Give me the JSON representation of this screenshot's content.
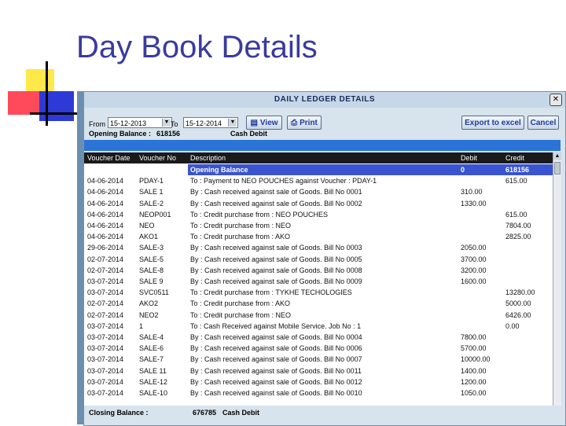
{
  "slide": {
    "title": "Day Book Details"
  },
  "window": {
    "title": "DAILY LEDGER DETAILS",
    "close_glyph": "✕",
    "filter": {
      "from_label": "From",
      "from_value": "15-12-2013",
      "to_label": "To",
      "to_value": "15-12-2014"
    },
    "buttons": {
      "view": "View",
      "print": "Print",
      "export": "Export to excel",
      "cancel": "Cancel"
    },
    "opening_balance": {
      "label": "Opening Balance :",
      "value": "618156",
      "type": "Cash Debit"
    },
    "columns": [
      "Voucher Date",
      "Voucher No",
      "Description",
      "Debit",
      "Credit"
    ],
    "rows": [
      [
        "",
        "",
        "Opening Balance",
        "0",
        "618156"
      ],
      [
        "04-06-2014",
        "PDAY-1",
        "To : Payment to NEO POUCHES against Voucher : PDAY-1",
        "",
        "615.00"
      ],
      [
        "04-06-2014",
        "SALE 1",
        "By : Cash received against sale of Goods. Bill No 0001",
        "310.00",
        ""
      ],
      [
        "04-06-2014",
        "SALE-2",
        "By : Cash received against sale of Goods. Bill No 0002",
        "1330.00",
        ""
      ],
      [
        "04-06-2014",
        "NEOP001",
        "To : Credit purchase from : NEO POUCHES",
        "",
        "615.00"
      ],
      [
        "04-06-2014",
        "NEO",
        "To : Credit purchase from : NEO",
        "",
        "7804.00"
      ],
      [
        "04-06-2014",
        "AKO1",
        "To : Credit purchase from : AKO",
        "",
        "2825.00"
      ],
      [
        "29-06-2014",
        "SALE-3",
        "By : Cash received against sale of Goods. Bill No 0003",
        "2050.00",
        ""
      ],
      [
        "02-07-2014",
        "SALE-5",
        "By : Cash received against sale of Goods. Bill No 0005",
        "3700.00",
        ""
      ],
      [
        "02-07-2014",
        "SALE-8",
        "By : Cash received against sale of Goods. Bill No 0008",
        "3200.00",
        ""
      ],
      [
        "03-07-2014",
        "SALE 9",
        "By : Cash received against sale of Goods. Bill No 0009",
        "1600.00",
        ""
      ],
      [
        "03-07-2014",
        "SVC0511",
        "To : Credit purchase from : TYKHE TECHOLOGIES",
        "",
        "13280.00"
      ],
      [
        "02-07-2014",
        "AKO2",
        "To : Credit purchase from : AKO",
        "",
        "5000.00"
      ],
      [
        "02-07-2014",
        "NEO2",
        "To : Credit purchase from : NEO",
        "",
        "6426.00"
      ],
      [
        "03-07-2014",
        "1",
        "To : Cash Received against Mobile Service. Job No : 1",
        "",
        "0.00"
      ],
      [
        "03-07-2014",
        "SALE-4",
        "By : Cash received against sale of Goods. Bill No 0004",
        "7800.00",
        ""
      ],
      [
        "03-07-2014",
        "SALE-6",
        "By : Cash received against sale of Goods. Bill No 0006",
        "5700.00",
        ""
      ],
      [
        "03-07-2014",
        "SALE-7",
        "By : Cash received against sale of Goods. Bill No 0007",
        "10000.00",
        ""
      ],
      [
        "03-07-2014",
        "SALE 11",
        "By : Cash received against sale of Goods. Bill No 0011",
        "1400.00",
        ""
      ],
      [
        "03-07-2014",
        "SALE-12",
        "By : Cash received against sale of Goods. Bill No 0012",
        "1200.00",
        ""
      ],
      [
        "03-07-2014",
        "SALE-10",
        "By : Cash received against sale of Goods. Bill No 0010",
        "1050.00",
        ""
      ]
    ],
    "closing_balance": {
      "label": "Closing Balance :",
      "value": "676785",
      "type": "Cash Debit"
    }
  }
}
